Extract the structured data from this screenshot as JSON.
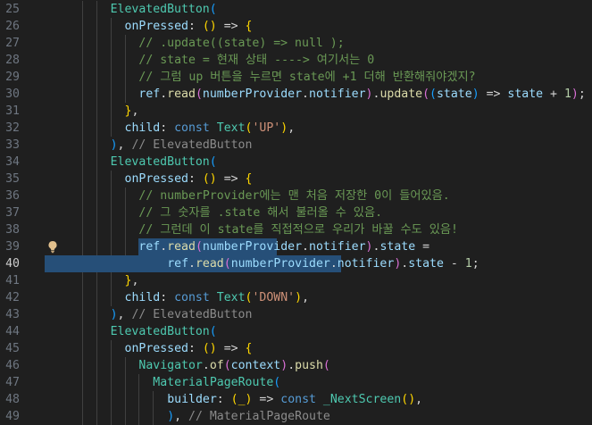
{
  "editor": {
    "first_line": 25,
    "active_line": 40,
    "lines": [
      {
        "n": 25,
        "tokens": [
          [
            "ElevatedButton",
            "class"
          ],
          [
            "(",
            "bracket3"
          ]
        ]
      },
      {
        "n": 26,
        "tokens": [
          [
            "onPressed",
            "prop"
          ],
          [
            ": ",
            "punct"
          ],
          [
            "()",
            "bracket1"
          ],
          [
            " => ",
            "punct"
          ],
          [
            "{",
            "bracket1"
          ]
        ]
      },
      {
        "n": 27,
        "tokens": [
          [
            "// .update((state) => null );",
            "comment"
          ]
        ]
      },
      {
        "n": 28,
        "tokens": [
          [
            "// state = 현재 상태 ----> 여기서는 0",
            "comment"
          ]
        ]
      },
      {
        "n": 29,
        "tokens": [
          [
            "// 그럼 up 버튼을 누르면 state에 +1 더해 반환해줘야겠지?",
            "comment"
          ]
        ]
      },
      {
        "n": 30,
        "tokens": [
          [
            "ref",
            "var"
          ],
          [
            ".",
            "punct"
          ],
          [
            "read",
            "func"
          ],
          [
            "(",
            "bracket2"
          ],
          [
            "numberProvider",
            "var"
          ],
          [
            ".",
            "punct"
          ],
          [
            "notifier",
            "prop"
          ],
          [
            ")",
            "bracket2"
          ],
          [
            ".",
            "punct"
          ],
          [
            "update",
            "func"
          ],
          [
            "(",
            "bracket2"
          ],
          [
            "(",
            "bracket3"
          ],
          [
            "state",
            "var"
          ],
          [
            ")",
            "bracket3"
          ],
          [
            " => ",
            "punct"
          ],
          [
            "state",
            "var"
          ],
          [
            " + ",
            "punct"
          ],
          [
            "1",
            "number"
          ],
          [
            ")",
            "bracket2"
          ],
          [
            ";",
            "punct"
          ]
        ]
      },
      {
        "n": 31,
        "tokens": [
          [
            "}",
            "bracket1"
          ],
          [
            ",",
            "punct"
          ]
        ]
      },
      {
        "n": 32,
        "tokens": [
          [
            "child",
            "prop"
          ],
          [
            ": ",
            "punct"
          ],
          [
            "const",
            "keyword"
          ],
          [
            " ",
            "punct"
          ],
          [
            "Text",
            "class"
          ],
          [
            "(",
            "bracket1"
          ],
          [
            "'UP'",
            "string"
          ],
          [
            ")",
            "bracket1"
          ],
          [
            ",",
            "punct"
          ]
        ]
      },
      {
        "n": 33,
        "tokens": [
          [
            ")",
            "bracket3"
          ],
          [
            ", ",
            "punct"
          ],
          [
            "// ElevatedButton",
            "hint"
          ]
        ]
      },
      {
        "n": 34,
        "tokens": [
          [
            "ElevatedButton",
            "class"
          ],
          [
            "(",
            "bracket3"
          ]
        ]
      },
      {
        "n": 35,
        "tokens": [
          [
            "onPressed",
            "prop"
          ],
          [
            ": ",
            "punct"
          ],
          [
            "()",
            "bracket1"
          ],
          [
            " => ",
            "punct"
          ],
          [
            "{",
            "bracket1"
          ]
        ]
      },
      {
        "n": 36,
        "tokens": [
          [
            "// numberProvider에는 맨 처음 저장한 0이 들어있음.",
            "comment"
          ]
        ]
      },
      {
        "n": 37,
        "tokens": [
          [
            "// 그 숫자를 .state 해서 불러올 수 있음.",
            "comment"
          ]
        ]
      },
      {
        "n": 38,
        "tokens": [
          [
            "// 그런데 이 state를 직접적으로 우리가 바꿀 수도 있음!",
            "comment"
          ]
        ]
      },
      {
        "n": 39,
        "tokens": [
          [
            "ref",
            "var"
          ],
          [
            ".",
            "punct"
          ],
          [
            "read",
            "func"
          ],
          [
            "(",
            "bracket2"
          ],
          [
            "numberProvider",
            "var"
          ],
          [
            ".",
            "punct"
          ],
          [
            "notifier",
            "prop"
          ],
          [
            ")",
            "bracket2"
          ],
          [
            ".",
            "punct"
          ],
          [
            "state",
            "prop"
          ],
          [
            " =",
            "punct"
          ]
        ]
      },
      {
        "n": 40,
        "tokens": [
          [
            "ref",
            "var"
          ],
          [
            ".",
            "punct"
          ],
          [
            "read",
            "func"
          ],
          [
            "(",
            "bracket2"
          ],
          [
            "numberProvider",
            "var"
          ],
          [
            ".",
            "punct"
          ],
          [
            "notifier",
            "prop"
          ],
          [
            ")",
            "bracket2"
          ],
          [
            ".",
            "punct"
          ],
          [
            "state",
            "prop"
          ],
          [
            " - ",
            "punct"
          ],
          [
            "1",
            "number"
          ],
          [
            ";",
            "punct"
          ]
        ]
      },
      {
        "n": 41,
        "tokens": [
          [
            "}",
            "bracket1"
          ],
          [
            ",",
            "punct"
          ]
        ]
      },
      {
        "n": 42,
        "tokens": [
          [
            "child",
            "prop"
          ],
          [
            ": ",
            "punct"
          ],
          [
            "const",
            "keyword"
          ],
          [
            " ",
            "punct"
          ],
          [
            "Text",
            "class"
          ],
          [
            "(",
            "bracket1"
          ],
          [
            "'DOWN'",
            "string"
          ],
          [
            ")",
            "bracket1"
          ],
          [
            ",",
            "punct"
          ]
        ]
      },
      {
        "n": 43,
        "tokens": [
          [
            ")",
            "bracket3"
          ],
          [
            ", ",
            "punct"
          ],
          [
            "// ElevatedButton",
            "hint"
          ]
        ]
      },
      {
        "n": 44,
        "tokens": [
          [
            "ElevatedButton",
            "class"
          ],
          [
            "(",
            "bracket3"
          ]
        ]
      },
      {
        "n": 45,
        "tokens": [
          [
            "onPressed",
            "prop"
          ],
          [
            ": ",
            "punct"
          ],
          [
            "()",
            "bracket1"
          ],
          [
            " => ",
            "punct"
          ],
          [
            "{",
            "bracket1"
          ]
        ]
      },
      {
        "n": 46,
        "tokens": [
          [
            "Navigator",
            "class"
          ],
          [
            ".",
            "punct"
          ],
          [
            "of",
            "func"
          ],
          [
            "(",
            "bracket2"
          ],
          [
            "context",
            "var"
          ],
          [
            ")",
            "bracket2"
          ],
          [
            ".",
            "punct"
          ],
          [
            "push",
            "func"
          ],
          [
            "(",
            "bracket2"
          ]
        ]
      },
      {
        "n": 47,
        "tokens": [
          [
            "MaterialPageRoute",
            "class"
          ],
          [
            "(",
            "bracket3"
          ]
        ]
      },
      {
        "n": 48,
        "tokens": [
          [
            "builder",
            "prop"
          ],
          [
            ": ",
            "punct"
          ],
          [
            "(_)",
            "bracket1"
          ],
          [
            " => ",
            "punct"
          ],
          [
            "const",
            "keyword"
          ],
          [
            " ",
            "punct"
          ],
          [
            "_NextScreen",
            "class"
          ],
          [
            "()",
            "bracket1"
          ],
          [
            ",",
            "punct"
          ]
        ]
      },
      {
        "n": 49,
        "tokens": [
          [
            ")",
            "bracket3"
          ],
          [
            ", ",
            "punct"
          ],
          [
            "// MaterialPageRoute",
            "hint"
          ]
        ]
      }
    ]
  },
  "lightbulb_icon": "lightbulb-icon",
  "colors": {
    "background": "#1f1f1f",
    "selection": "#264f78",
    "comment": "#6a9955",
    "class": "#4ec9b0",
    "keyword": "#569cd6",
    "string": "#ce9178"
  }
}
